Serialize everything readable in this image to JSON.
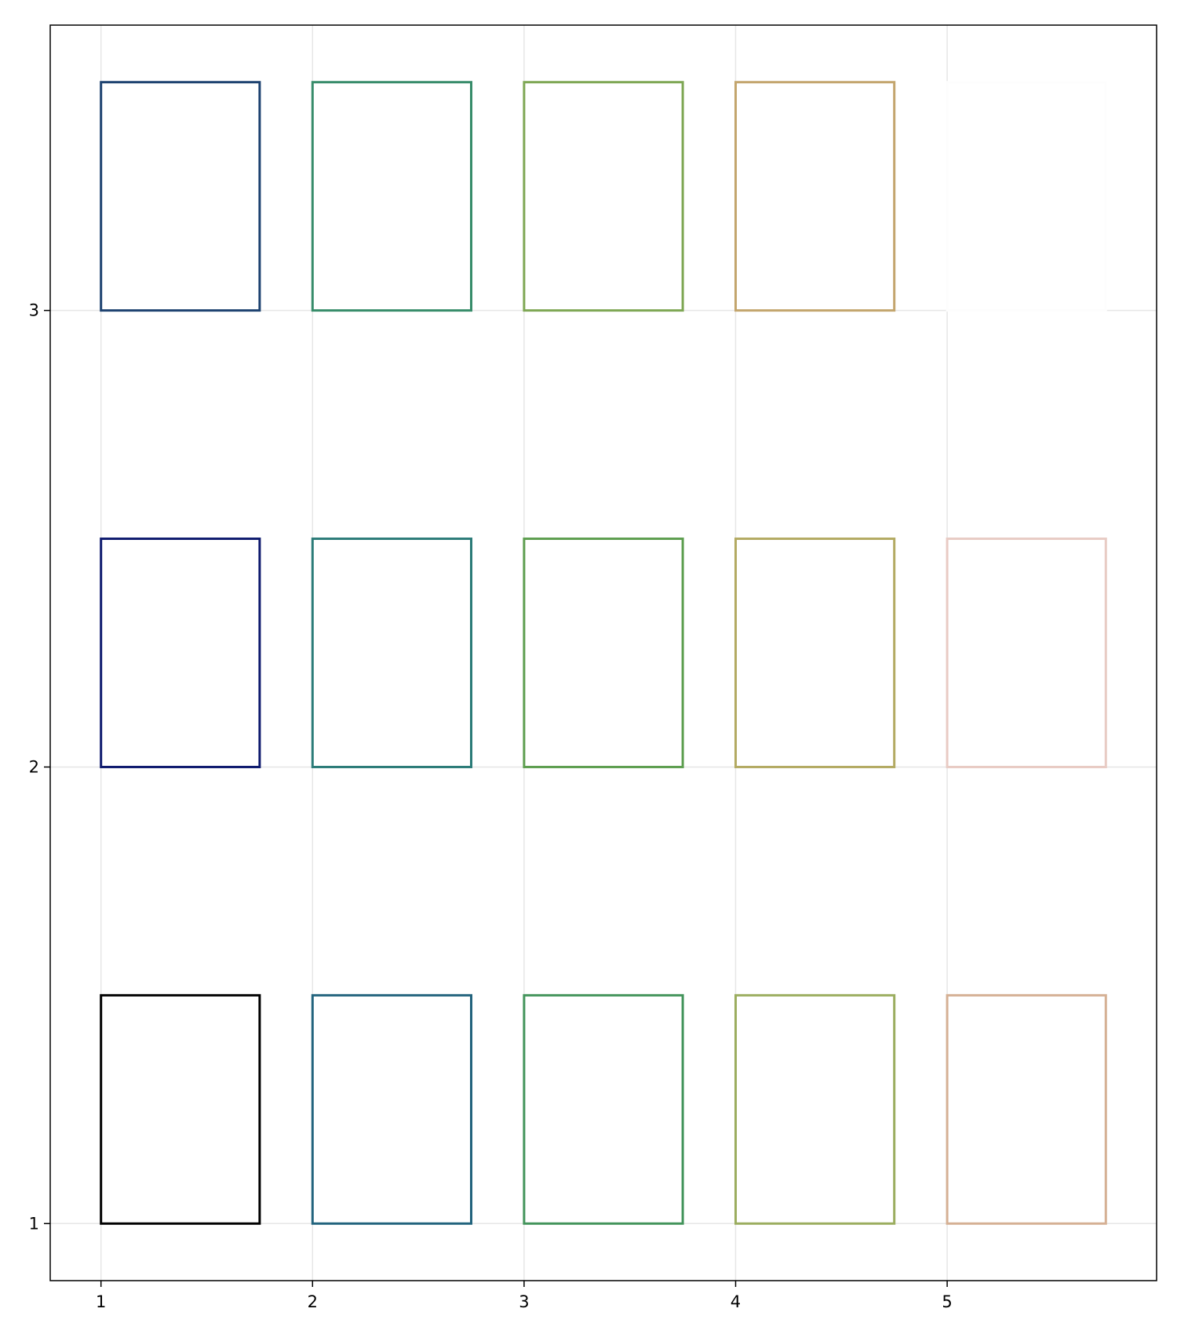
{
  "chart_data": {
    "type": "rect-grid",
    "title": "",
    "xlabel": "",
    "ylabel": "",
    "xlim": [
      0.76,
      5.99
    ],
    "ylim": [
      0.875,
      3.625
    ],
    "grid": true,
    "legend": "none",
    "x_ticks": [
      "1",
      "2",
      "3",
      "4",
      "5"
    ],
    "y_ticks": [
      "1",
      "2",
      "3"
    ],
    "rect_width": 0.75,
    "rect_height": 0.5,
    "rects": [
      {
        "x": 1,
        "y": 1,
        "color": "#000000"
      },
      {
        "x": 1,
        "y": 2,
        "color": "#0e1a6e"
      },
      {
        "x": 1,
        "y": 3,
        "color": "#1d4270"
      },
      {
        "x": 2,
        "y": 1,
        "color": "#22637d"
      },
      {
        "x": 2,
        "y": 2,
        "color": "#2b7b78"
      },
      {
        "x": 2,
        "y": 3,
        "color": "#378c6a"
      },
      {
        "x": 3,
        "y": 1,
        "color": "#43945b"
      },
      {
        "x": 3,
        "y": 2,
        "color": "#5d9e4f"
      },
      {
        "x": 3,
        "y": 3,
        "color": "#7ea754"
      },
      {
        "x": 4,
        "y": 1,
        "color": "#9bad5f"
      },
      {
        "x": 4,
        "y": 2,
        "color": "#b3aa62"
      },
      {
        "x": 4,
        "y": 3,
        "color": "#c3a56d"
      },
      {
        "x": 5,
        "y": 1,
        "color": "#d5b094"
      },
      {
        "x": 5,
        "y": 2,
        "color": "#e8cbc4"
      },
      {
        "x": 5,
        "y": 3,
        "color": "#fdfdfd"
      }
    ]
  }
}
